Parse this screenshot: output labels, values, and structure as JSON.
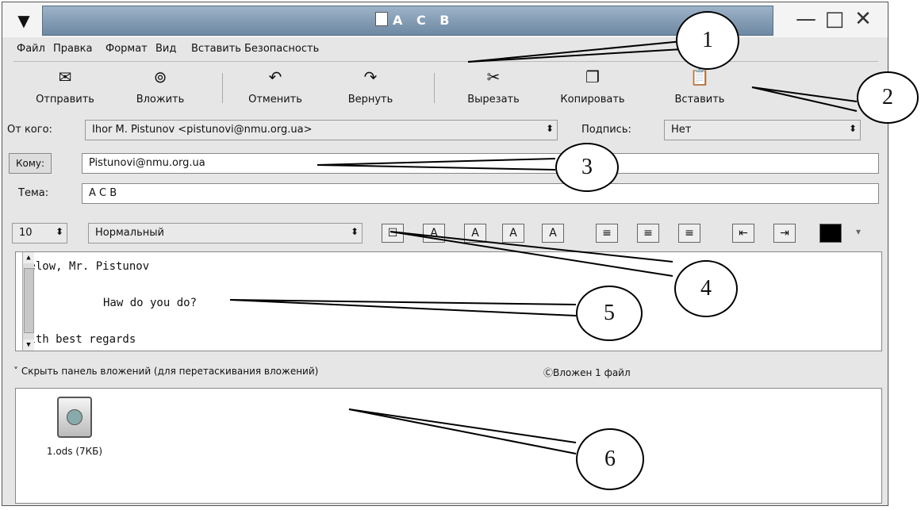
{
  "window": {
    "title": "A C B",
    "menu_arrow": "▼",
    "controls": [
      "—",
      "□",
      "✕"
    ]
  },
  "menu": [
    "Файл",
    "Правка",
    "Формат",
    "Вид",
    "Вставить",
    "Безопасность"
  ],
  "toolbar": [
    {
      "label": "Отправить",
      "icon": "send-icon"
    },
    {
      "label": "Вложить",
      "icon": "attach-icon"
    },
    {
      "label": "Отменить",
      "icon": "undo-icon"
    },
    {
      "label": "Вернуть",
      "icon": "redo-icon"
    },
    {
      "label": "Вырезать",
      "icon": "cut-icon"
    },
    {
      "label": "Копировать",
      "icon": "copy-icon"
    },
    {
      "label": "Вставить",
      "icon": "paste-icon"
    }
  ],
  "header": {
    "from_label": "От кого:",
    "from_value": "Ihor M. Pistunov <pistunovi@nmu.org.ua>",
    "signature_label": "Подпись:",
    "signature_value": "Нет",
    "to_button": "Кому:",
    "to_value": "Pistunovi@nmu.org.ua",
    "subject_label": "Тема:",
    "subject_value": "A C B"
  },
  "format": {
    "size_value": "10",
    "paragraph_style": "Нормальный",
    "style_buttons": [
      "☐",
      "A",
      "A",
      "A",
      "A"
    ],
    "align_buttons": [
      "≡",
      "≡",
      "≡"
    ],
    "indent_buttons": [
      "⇤",
      "⇥"
    ],
    "color_value": "#000000"
  },
  "body": {
    "lines": [
      "Helow, Mr. Pistunov",
      "Haw do you do?",
      "With best regards"
    ]
  },
  "attachments": {
    "hide_label": "˅ Скрыть панель вложений (для перетаскивания вложений)",
    "count_label": "Вложен 1 файл",
    "files": [
      {
        "name": "1.ods (7КБ)"
      }
    ]
  },
  "callouts": [
    "1",
    "2",
    "3",
    "4",
    "5",
    "6"
  ]
}
